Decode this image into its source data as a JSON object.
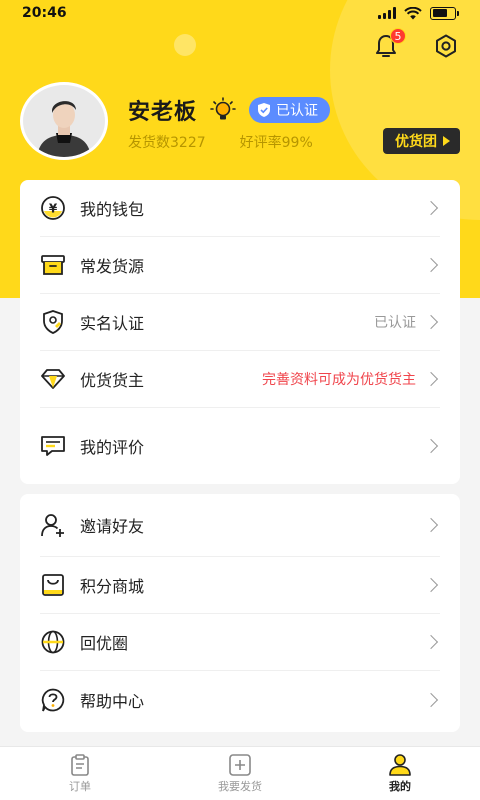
{
  "status": {
    "time": "20:46"
  },
  "header": {
    "notification_count": "5"
  },
  "profile": {
    "name": "安老板",
    "verified_label": "已认证",
    "shipments": "发货数3227",
    "rating": "好评率99%",
    "vip_button": "优货团"
  },
  "menu1": [
    {
      "label": "我的钱包",
      "icon": "wallet-icon",
      "extra": ""
    },
    {
      "label": "常发货源",
      "icon": "box-icon",
      "extra": ""
    },
    {
      "label": "实名认证",
      "icon": "id-verify-icon",
      "extra": "已认证"
    },
    {
      "label": "优货货主",
      "icon": "diamond-icon",
      "extra": "完善资料可成为优货货主"
    },
    {
      "label": "我的评价",
      "icon": "comment-icon",
      "extra": ""
    }
  ],
  "menu2": [
    {
      "label": "邀请好友",
      "icon": "add-friend-icon"
    },
    {
      "label": "积分商城",
      "icon": "shopping-bag-icon"
    },
    {
      "label": "回优圈",
      "icon": "globe-icon"
    },
    {
      "label": "帮助中心",
      "icon": "help-icon"
    }
  ],
  "tabbar": {
    "orders": "订单",
    "ship": "我要发货",
    "mine": "我的"
  },
  "colors": {
    "accent": "#ffd91a",
    "verified": "#5b8cff",
    "warning": "#f0454c"
  }
}
